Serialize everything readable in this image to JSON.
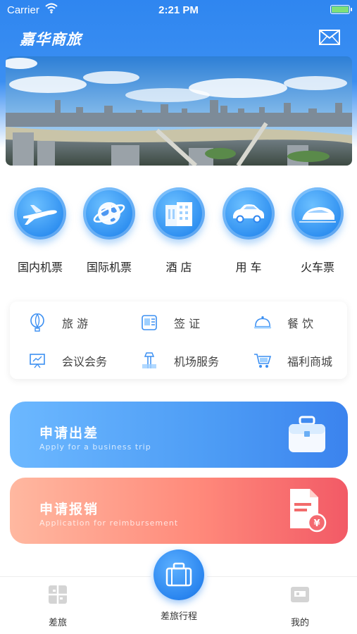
{
  "status_bar": {
    "carrier": "Carrier",
    "time": "2:21 PM"
  },
  "header": {
    "title": "嘉华商旅",
    "mail_icon": "mail-icon"
  },
  "services": [
    {
      "label": "国内机票",
      "icon": "airplane-icon"
    },
    {
      "label": "国际机票",
      "icon": "globe-icon"
    },
    {
      "label": "酒 店",
      "icon": "hotel-building-icon"
    },
    {
      "label": "用 车",
      "icon": "car-icon"
    },
    {
      "label": "火车票",
      "icon": "train-icon"
    }
  ],
  "sub_services": [
    {
      "label": "旅 游",
      "icon": "balloon-icon"
    },
    {
      "label": "签 证",
      "icon": "passport-icon"
    },
    {
      "label": "餐 饮",
      "icon": "dish-cover-icon"
    },
    {
      "label": "会议会务",
      "icon": "presentation-icon"
    },
    {
      "label": "机场服务",
      "icon": "airport-tower-icon"
    },
    {
      "label": "福利商城",
      "icon": "shopping-cart-icon"
    }
  ],
  "actions": {
    "trip": {
      "title": "申请出差",
      "subtitle": "Apply for a business trip",
      "icon": "briefcase-icon"
    },
    "reimbursement": {
      "title": "申请报销",
      "subtitle": "Application for reimbursement",
      "icon": "invoice-yen-icon"
    }
  },
  "tabbar": {
    "left": {
      "label": "差旅",
      "icon": "grid-icon"
    },
    "center": {
      "label": "差旅行程",
      "icon": "briefcase-icon"
    },
    "right": {
      "label": "我的",
      "icon": "profile-card-icon"
    }
  },
  "colors": {
    "primary": "#2f86f0",
    "trip_card": "#4d9cf5",
    "reimb_card": "#ff8a7b"
  }
}
